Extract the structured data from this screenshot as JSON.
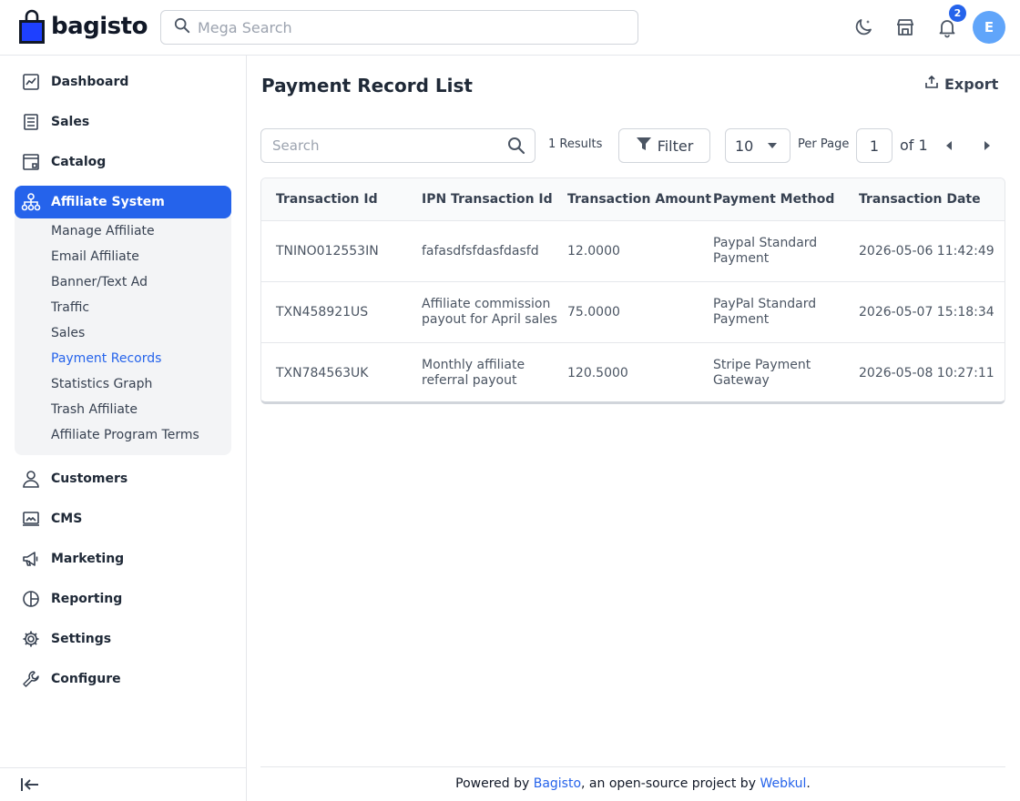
{
  "header": {
    "logo_text": "bagisto",
    "search_placeholder": "Mega Search",
    "notification_count": "2",
    "avatar_initial": "E"
  },
  "sidebar": {
    "items": [
      {
        "label": "Dashboard",
        "icon": "dashboard-icon"
      },
      {
        "label": "Sales",
        "icon": "sales-icon"
      },
      {
        "label": "Catalog",
        "icon": "catalog-icon"
      },
      {
        "label": "Affiliate System",
        "icon": "affiliate-icon",
        "active": true
      },
      {
        "label": "Customers",
        "icon": "customers-icon"
      },
      {
        "label": "CMS",
        "icon": "cms-icon"
      },
      {
        "label": "Marketing",
        "icon": "marketing-icon"
      },
      {
        "label": "Reporting",
        "icon": "reporting-icon"
      },
      {
        "label": "Settings",
        "icon": "settings-icon"
      },
      {
        "label": "Configure",
        "icon": "configure-icon"
      }
    ],
    "submenu": [
      {
        "label": "Manage Affiliate"
      },
      {
        "label": "Email Affiliate"
      },
      {
        "label": "Banner/Text Ad"
      },
      {
        "label": "Traffic"
      },
      {
        "label": "Sales"
      },
      {
        "label": "Payment Records",
        "active": true
      },
      {
        "label": "Statistics Graph"
      },
      {
        "label": "Trash Affiliate"
      },
      {
        "label": "Affiliate Program Terms"
      }
    ]
  },
  "main": {
    "title": "Payment Record List",
    "export_label": "Export",
    "search_placeholder": "Search",
    "results": "1 Results",
    "filter_label": "Filter",
    "per_page_value": "10",
    "per_page_label": "Per Page",
    "page_value": "1",
    "of_label": "of 1"
  },
  "table": {
    "columns": [
      "Transaction Id",
      "IPN Transaction Id",
      "Transaction Amount",
      "Payment Method",
      "Transaction Date"
    ],
    "rows": [
      [
        "TNINO012553IN",
        "fafasdfsfdasfdasfd",
        "12.0000",
        "Paypal Standard Payment",
        "2026-05-06 11:42:49"
      ],
      [
        "TXN458921US",
        "Affiliate commission payout for April sales",
        "75.0000",
        "PayPal Standard Payment",
        "2026-05-07 15:18:34"
      ],
      [
        "TXN784563UK",
        "Monthly affiliate referral payout",
        "120.5000",
        "Stripe Payment Gateway",
        "2026-05-08 10:27:11"
      ]
    ]
  },
  "footer": {
    "prefix": "Powered by ",
    "link1": "Bagisto",
    "middle": ", an open-source project by ",
    "link2": "Webkul",
    "suffix": "."
  },
  "colors": {
    "accent": "#2563eb",
    "avatar": "#60a5fa",
    "submenu_bg": "#f3f4f6"
  }
}
